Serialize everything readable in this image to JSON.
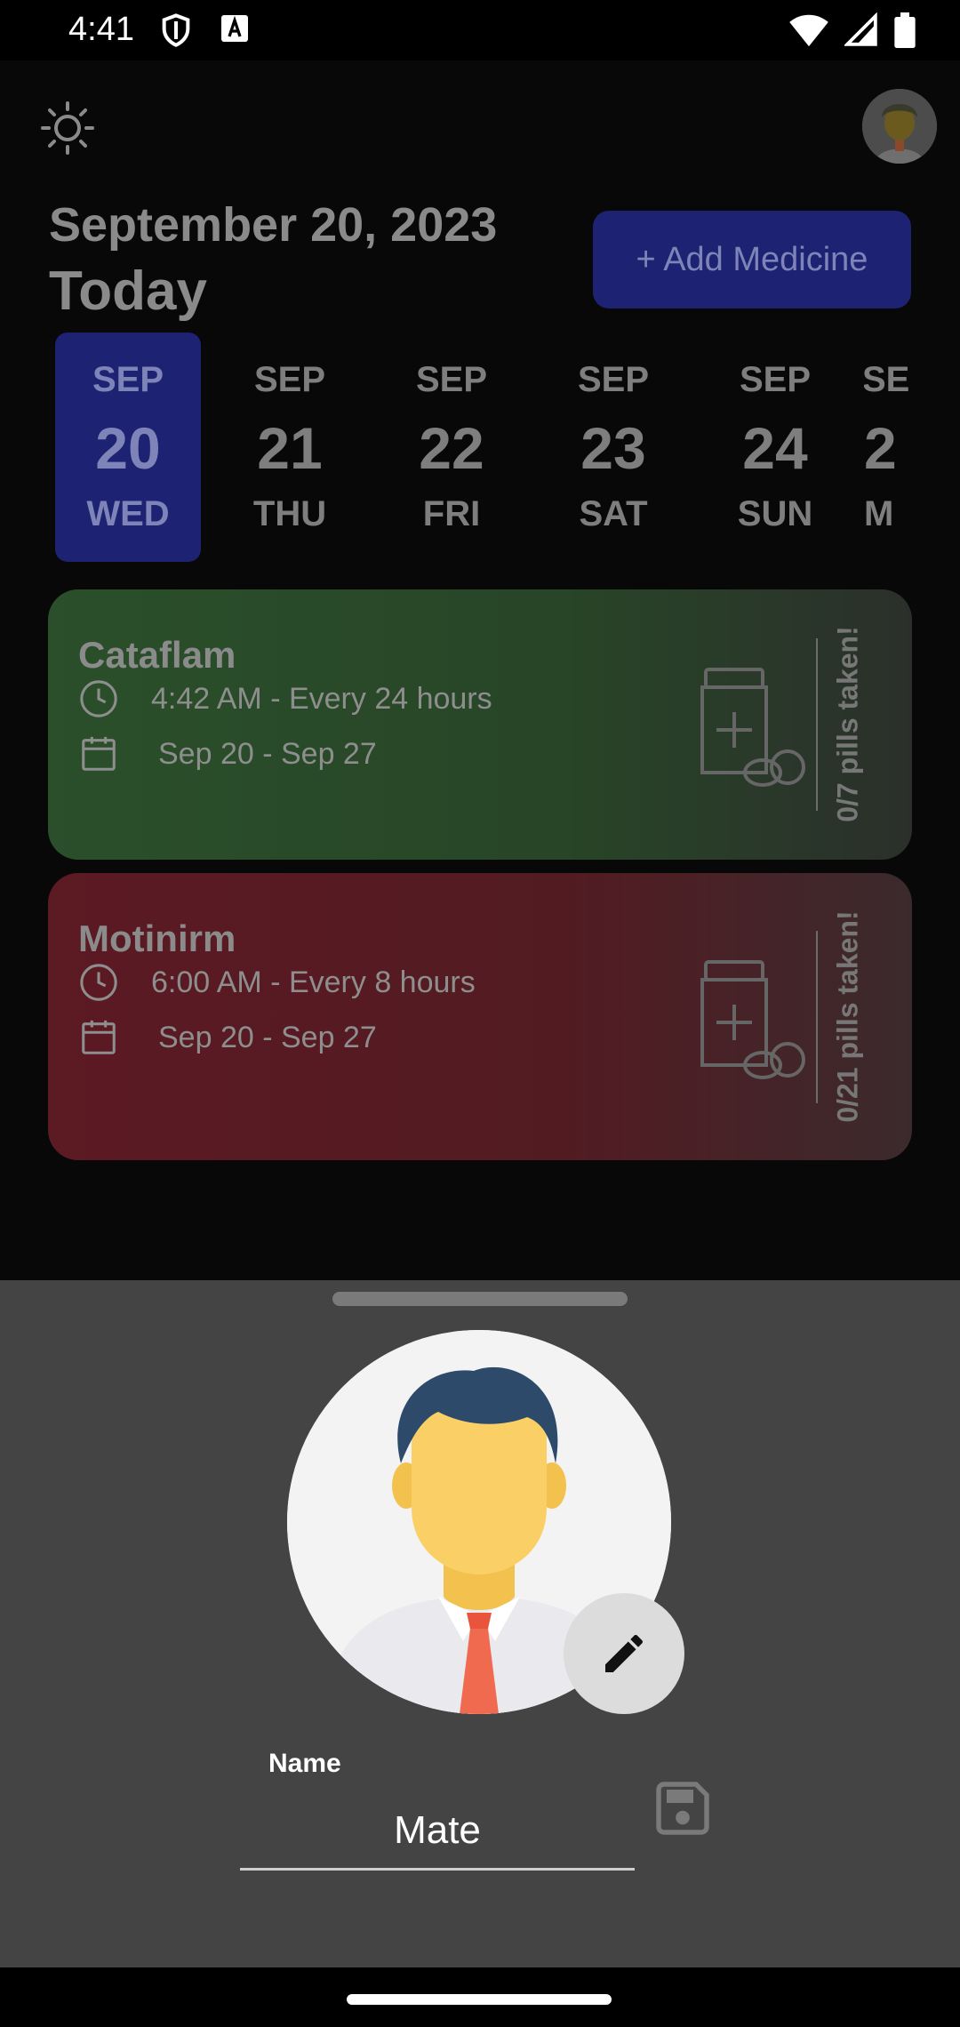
{
  "status_bar": {
    "time": "4:41",
    "left_icons": [
      "shield-icon",
      "font-a-icon"
    ],
    "right_icons": [
      "wifi-icon",
      "signal-icon",
      "battery-icon"
    ]
  },
  "header": {
    "theme_icon": "sun-icon",
    "date": "September 20, 2023",
    "today": "Today",
    "add_button": "+ Add Medicine"
  },
  "days": [
    {
      "month": "SEP",
      "day": "20",
      "weekday": "WED",
      "selected": true
    },
    {
      "month": "SEP",
      "day": "21",
      "weekday": "THU",
      "selected": false
    },
    {
      "month": "SEP",
      "day": "22",
      "weekday": "FRI",
      "selected": false
    },
    {
      "month": "SEP",
      "day": "23",
      "weekday": "SAT",
      "selected": false
    },
    {
      "month": "SEP",
      "day": "24",
      "weekday": "SUN",
      "selected": false
    },
    {
      "month": "SEP",
      "day": "2",
      "weekday": "M",
      "selected": false
    }
  ],
  "medicines": [
    {
      "name": "Cataflam",
      "schedule": "4:42 AM - Every 24 hours",
      "range": "Sep 20 -  Sep 27",
      "taken": "0/7 pills taken!",
      "color": "#2a4f2a"
    },
    {
      "name": "Motinirm",
      "schedule": "6:00 AM - Every 8 hours",
      "range": "Sep 20 -  Sep 27",
      "taken": "0/21 pills taken!",
      "color": "#5c1a23"
    }
  ],
  "profile_sheet": {
    "name_label": "Name",
    "name_value": "Mate",
    "edit_icon": "pencil-icon",
    "save_icon": "save-icon"
  },
  "colors": {
    "accent": "#1d2272",
    "sheet_bg": "#444444"
  }
}
